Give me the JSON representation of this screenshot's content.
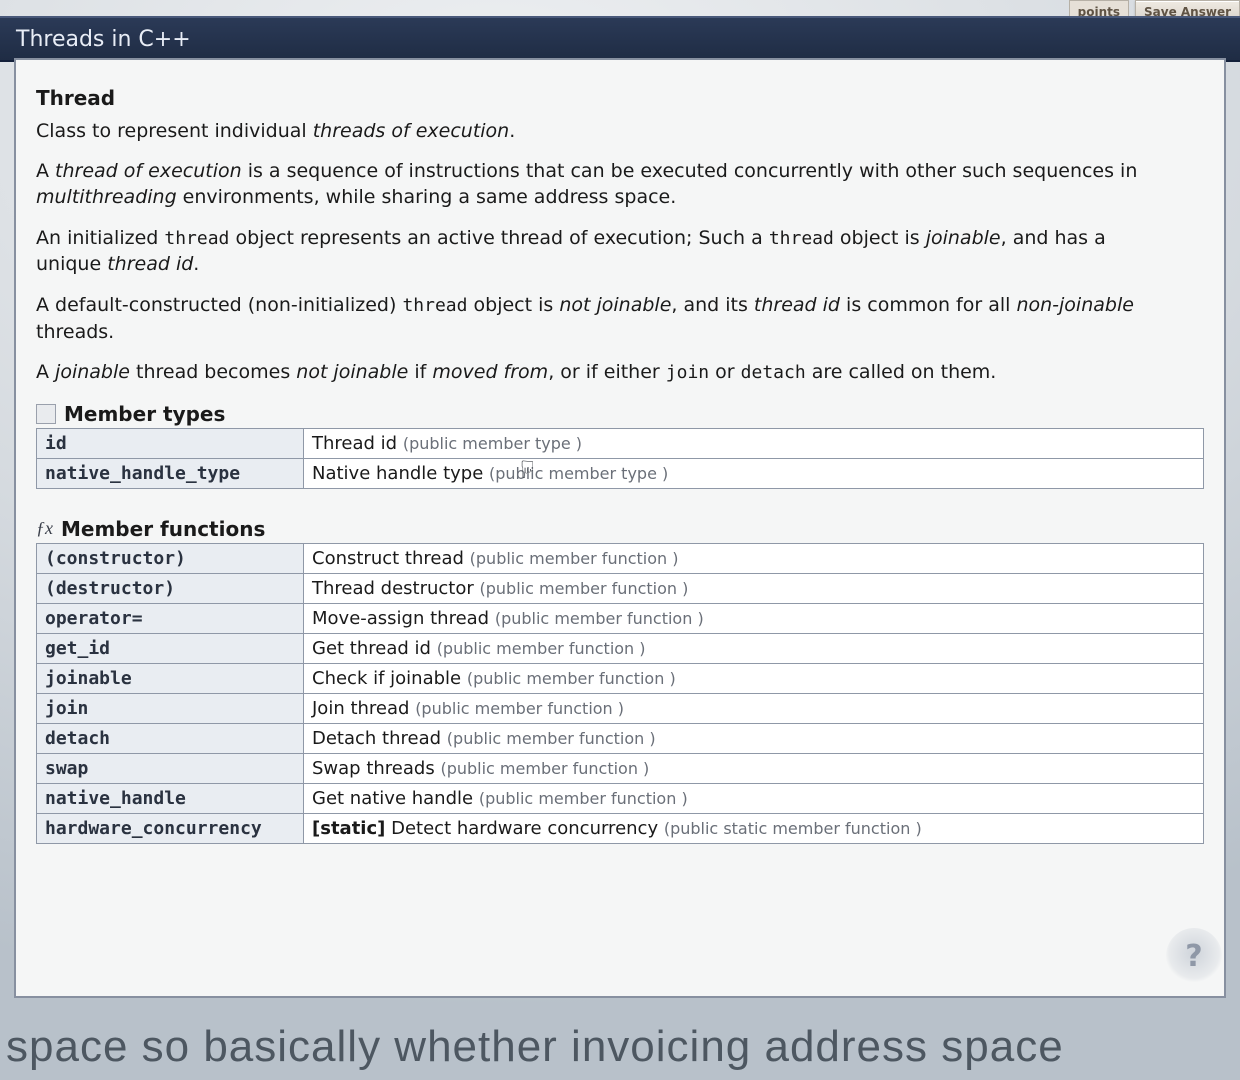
{
  "top": {
    "points": "points",
    "save_answer": "Save Answer"
  },
  "title": "Threads in C++",
  "thread_heading": "Thread",
  "paragraphs": {
    "p1a": "Class to represent individual ",
    "p1b": "threads of execution",
    "p1c": ".",
    "p2a": "A ",
    "p2b": "thread of execution",
    "p2c": " is a sequence of instructions that can be executed concurrently with other such sequences in ",
    "p2d": "multithreading",
    "p2e": " environments, while sharing a same address space.",
    "p3a": "An initialized ",
    "p3b": "thread",
    "p3c": " object represents an active thread of execution; Such a ",
    "p3d": "thread",
    "p3e": " object is ",
    "p3f": "joinable",
    "p3g": ", and has a unique ",
    "p3h": "thread id",
    "p3i": ".",
    "p4a": "A default-constructed (non-initialized) ",
    "p4b": "thread",
    "p4c": " object is ",
    "p4d": "not joinable",
    "p4e": ", and its ",
    "p4f": "thread id",
    "p4g": " is common for all ",
    "p4h": "non-joinable",
    "p4i": " threads.",
    "p5a": "A ",
    "p5b": "joinable",
    "p5c": " thread becomes ",
    "p5d": "not joinable",
    "p5e": " if ",
    "p5f": "moved from",
    "p5g": ", or if either ",
    "p5h": "join",
    "p5i": " or ",
    "p5j": "detach",
    "p5k": " are called on them."
  },
  "sections": {
    "types_title": "Member types",
    "funcs_title": "Member functions"
  },
  "member_types": [
    {
      "name": "id",
      "desc": "Thread id",
      "qual": "(public member type )"
    },
    {
      "name": "native_handle_type",
      "desc": "Native handle type",
      "qual": "(public member type )"
    }
  ],
  "member_functions": [
    {
      "name": "(constructor)",
      "tag": "",
      "desc": "Construct thread",
      "qual": "(public member function )"
    },
    {
      "name": "(destructor)",
      "tag": "",
      "desc": "Thread destructor",
      "qual": "(public member function )"
    },
    {
      "name": "operator=",
      "tag": "",
      "desc": "Move-assign thread",
      "qual": "(public member function )"
    },
    {
      "name": "get_id",
      "tag": "",
      "desc": "Get thread id",
      "qual": "(public member function )"
    },
    {
      "name": "joinable",
      "tag": "",
      "desc": "Check if joinable",
      "qual": "(public member function )"
    },
    {
      "name": "join",
      "tag": "",
      "desc": "Join thread",
      "qual": "(public member function )"
    },
    {
      "name": "detach",
      "tag": "",
      "desc": "Detach thread",
      "qual": "(public member function )"
    },
    {
      "name": "swap",
      "tag": "",
      "desc": "Swap threads",
      "qual": "(public member function )"
    },
    {
      "name": "native_handle",
      "tag": "",
      "desc": "Get native handle",
      "qual": "(public member function )"
    },
    {
      "name": "hardware_concurrency",
      "tag": "[static]",
      "desc": "Detect hardware concurrency",
      "qual": "(public static member function )"
    }
  ],
  "caption": "space so basically whether invoicing address space",
  "stamp": "?"
}
